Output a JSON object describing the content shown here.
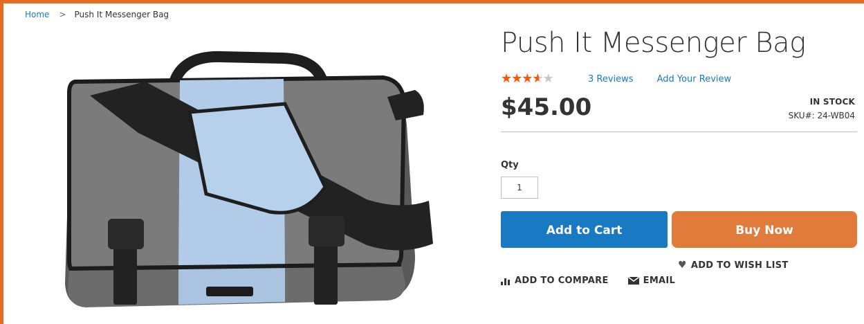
{
  "breadcrumb": {
    "home": "Home",
    "separator": ">",
    "current": "Push It Messenger Bag"
  },
  "product": {
    "title": "Push It Messenger Bag",
    "rating_fraction": 0.6,
    "stars": "★★★★★",
    "reviews_link": "3  Reviews",
    "add_review": "Add Your Review",
    "price": "$45.00",
    "stock": "IN STOCK",
    "sku_label": "SKU#:",
    "sku": "24-WB04"
  },
  "purchase": {
    "qty_label": "Qty",
    "qty_value": "1",
    "add_to_cart": "Add to Cart",
    "buy_now": "Buy Now"
  },
  "actions": {
    "wishlist": "ADD TO WISH LIST",
    "compare": "ADD TO COMPARE",
    "email": "EMAIL"
  },
  "icons": {
    "wishlist": "heart-icon",
    "compare": "bar-chart-icon",
    "email": "envelope-icon"
  },
  "colors": {
    "accent_border": "#e36d1d",
    "link": "#1979c3",
    "cart_button": "#1979c3",
    "buy_button": "#e07b3c",
    "star_fill": "#ff5501"
  }
}
